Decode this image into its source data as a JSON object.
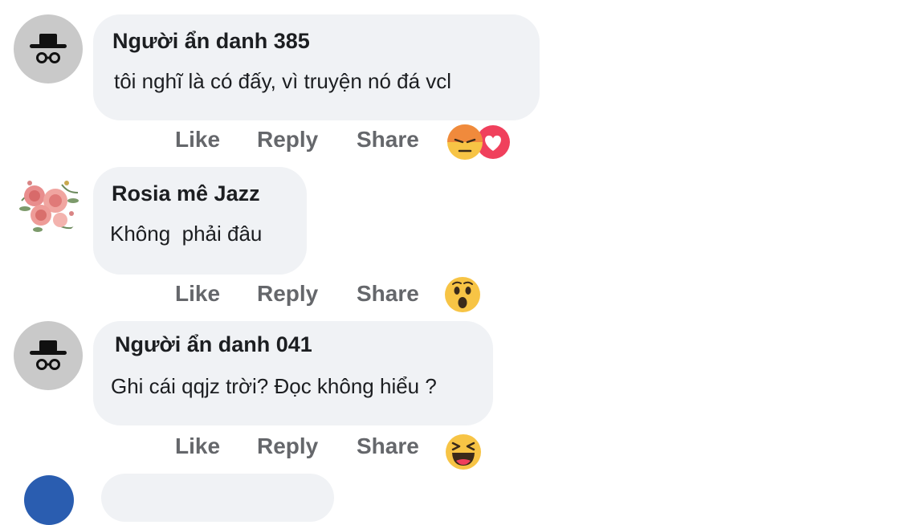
{
  "comments": [
    {
      "author": "Người ẩn danh 385",
      "text": "tôi nghĩ là có đấy, vì truyện nó đá vcl",
      "actions": {
        "like": "Like",
        "reply": "Reply",
        "share": "Share"
      },
      "reactions": [
        "angry-reaction-icon",
        "love-reaction-icon"
      ],
      "avatar": "anonymous-avatar"
    },
    {
      "author": "Rosia mê Jazz",
      "text": "Không  phải đâu",
      "actions": {
        "like": "Like",
        "reply": "Reply",
        "share": "Share"
      },
      "reactions": [
        "wow-reaction-icon"
      ],
      "avatar": "flower-avatar"
    },
    {
      "author": "Người ẩn danh 041",
      "text": "Ghi cái qqjz trời? Đọc không hiểu ?",
      "actions": {
        "like": "Like",
        "reply": "Reply",
        "share": "Share"
      },
      "reactions": [
        "haha-reaction-icon"
      ],
      "avatar": "anonymous-avatar"
    }
  ],
  "colors": {
    "bubble": "#f0f2f5",
    "action_text": "#65676b",
    "name_text": "#1c1e21",
    "reaction_yellow": "#f7c445",
    "reaction_orange": "#f08a3c",
    "reaction_love": "#f0405c",
    "avatar_gray": "#c9c9c9"
  }
}
